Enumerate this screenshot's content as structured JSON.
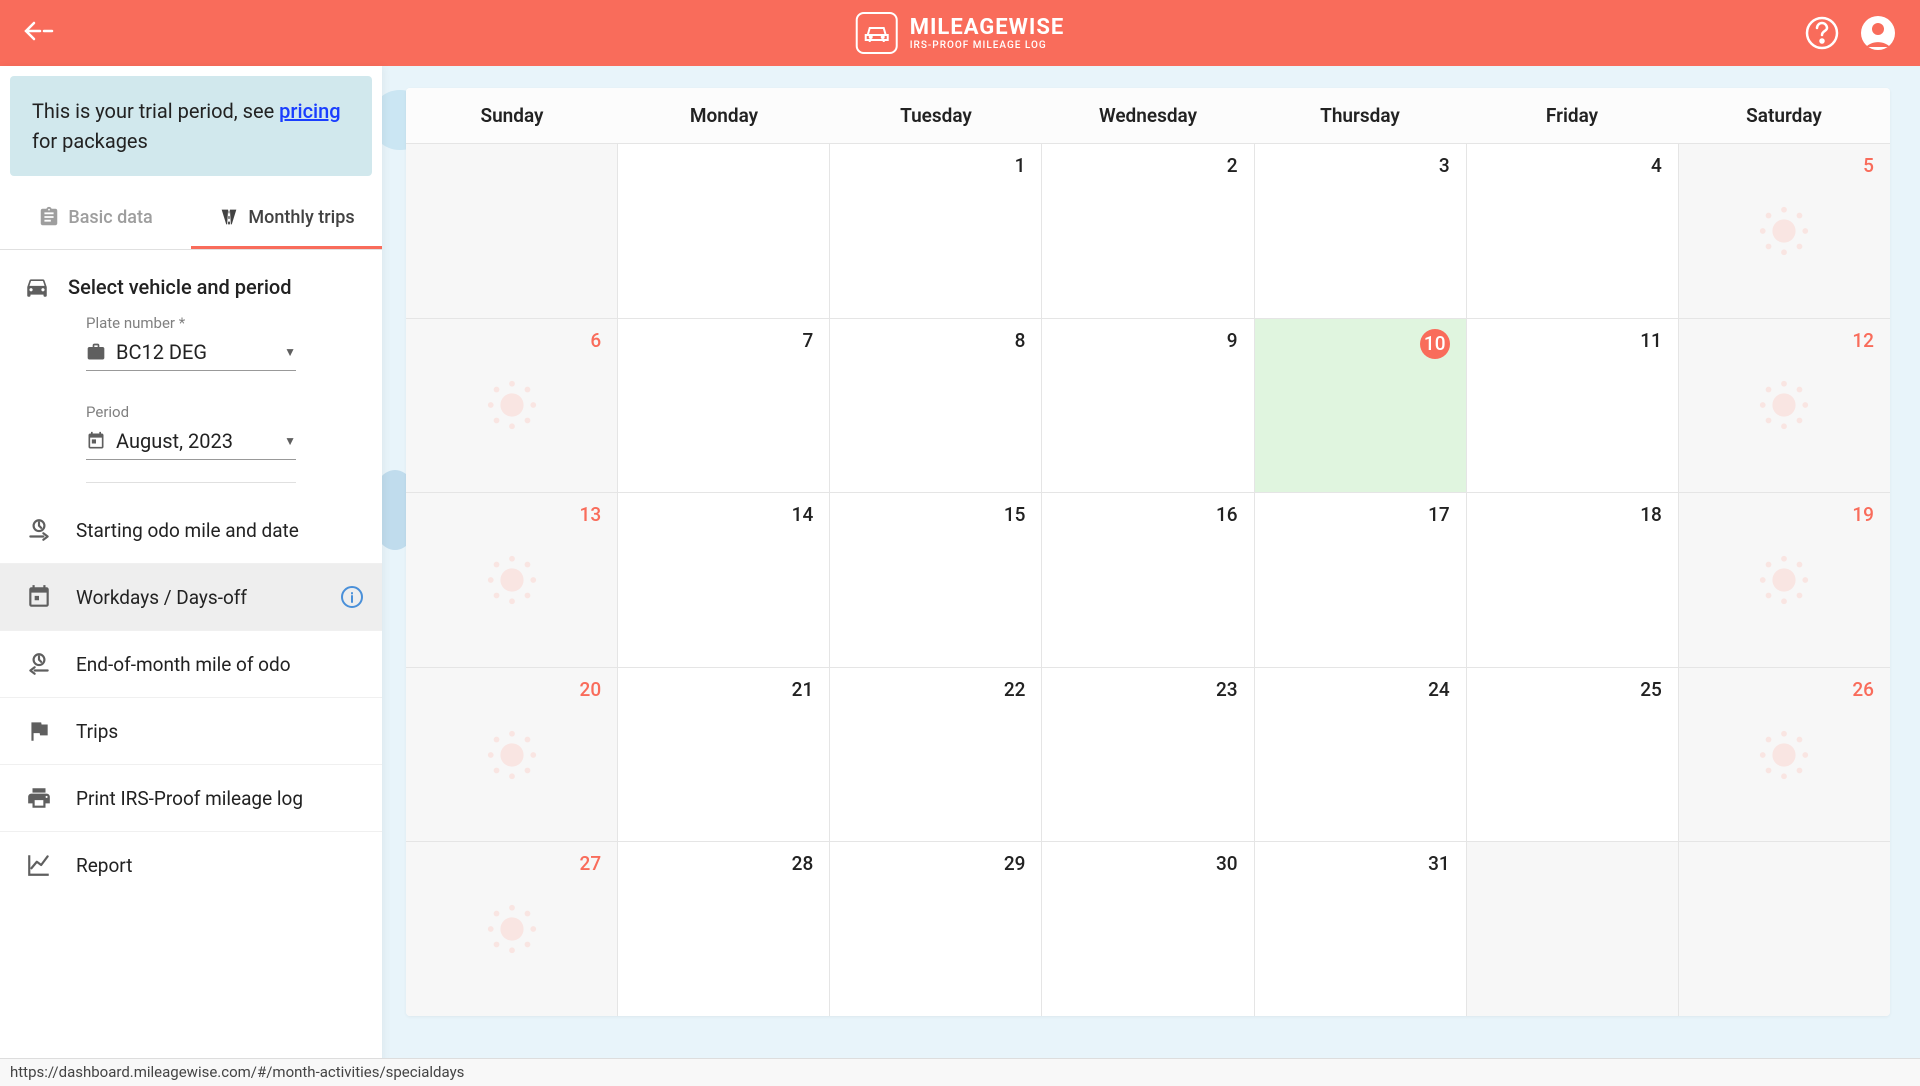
{
  "header": {
    "brand_title": "MILEAGEWISE",
    "brand_subtitle": "IRS-PROOF MILEAGE LOG"
  },
  "trial": {
    "prefix": "This is your trial period, see ",
    "link": "pricing",
    "suffix": " for packages"
  },
  "tabs": {
    "basic": "Basic data",
    "monthly": "Monthly trips"
  },
  "section": {
    "title": "Select vehicle and period"
  },
  "form": {
    "plate_label": "Plate number *",
    "plate_value": "BC12 DEG",
    "period_label": "Period",
    "period_value": "August, 2023"
  },
  "menu": {
    "starting": "Starting odo mile and date",
    "workdays": "Workdays / Days-off",
    "endmonth": "End-of-month mile of odo",
    "trips": "Trips",
    "print": "Print IRS-Proof mileage log",
    "report": "Report"
  },
  "calendar": {
    "days": [
      "Sunday",
      "Monday",
      "Tuesday",
      "Wednesday",
      "Thursday",
      "Friday",
      "Saturday"
    ],
    "cells": [
      [
        {
          "num": "",
          "weekend": true,
          "emptyWeekend": true,
          "sun": false
        },
        {
          "num": "",
          "weekend": false
        },
        {
          "num": "1",
          "weekend": false
        },
        {
          "num": "2",
          "weekend": false
        },
        {
          "num": "3",
          "weekend": false
        },
        {
          "num": "4",
          "weekend": false
        },
        {
          "num": "5",
          "weekend": true,
          "emptyWeekend": true,
          "sun": true
        }
      ],
      [
        {
          "num": "6",
          "weekend": true,
          "emptyWeekend": true,
          "sun": true
        },
        {
          "num": "7",
          "weekend": false
        },
        {
          "num": "8",
          "weekend": false
        },
        {
          "num": "9",
          "weekend": false
        },
        {
          "num": "10",
          "weekend": false,
          "today": true
        },
        {
          "num": "11",
          "weekend": false
        },
        {
          "num": "12",
          "weekend": true,
          "emptyWeekend": true,
          "sun": true
        }
      ],
      [
        {
          "num": "13",
          "weekend": true,
          "emptyWeekend": true,
          "sun": true
        },
        {
          "num": "14",
          "weekend": false
        },
        {
          "num": "15",
          "weekend": false
        },
        {
          "num": "16",
          "weekend": false
        },
        {
          "num": "17",
          "weekend": false
        },
        {
          "num": "18",
          "weekend": false
        },
        {
          "num": "19",
          "weekend": true,
          "emptyWeekend": true,
          "sun": true
        }
      ],
      [
        {
          "num": "20",
          "weekend": true,
          "emptyWeekend": true,
          "sun": true
        },
        {
          "num": "21",
          "weekend": false
        },
        {
          "num": "22",
          "weekend": false
        },
        {
          "num": "23",
          "weekend": false
        },
        {
          "num": "24",
          "weekend": false
        },
        {
          "num": "25",
          "weekend": false
        },
        {
          "num": "26",
          "weekend": true,
          "emptyWeekend": true,
          "sun": true
        }
      ],
      [
        {
          "num": "27",
          "weekend": true,
          "emptyWeekend": true,
          "sun": true
        },
        {
          "num": "28",
          "weekend": false
        },
        {
          "num": "29",
          "weekend": false
        },
        {
          "num": "30",
          "weekend": false
        },
        {
          "num": "31",
          "weekend": false
        },
        {
          "num": "",
          "weekend": false,
          "emptyWeekend": true
        },
        {
          "num": "",
          "weekend": true,
          "emptyWeekend": true
        }
      ]
    ]
  },
  "status": {
    "url": "https://dashboard.mileagewise.com/#/month-activities/specialdays"
  }
}
